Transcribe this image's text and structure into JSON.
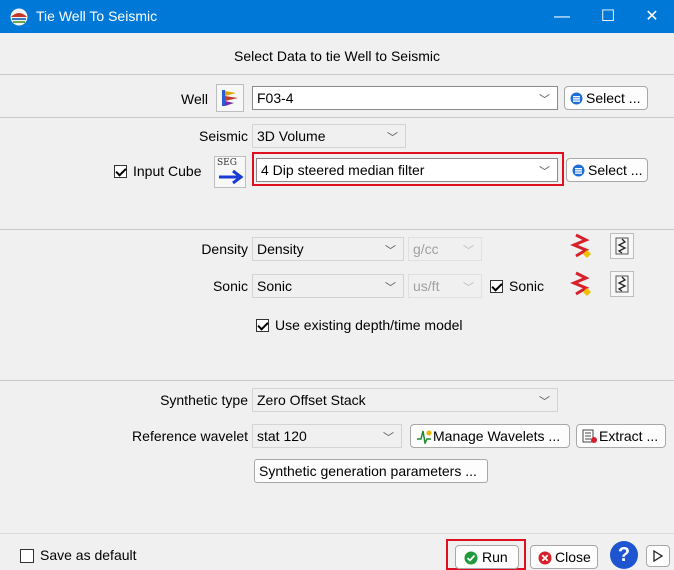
{
  "window": {
    "title": "Tie Well To Seismic",
    "min_glyph": "—",
    "max_glyph": "☐",
    "close_glyph": "✕"
  },
  "header": {
    "title": "Select Data to tie Well to Seismic"
  },
  "well": {
    "label": "Well",
    "value": "F03-4",
    "select_label": "Select ..."
  },
  "seismic": {
    "label": "Seismic",
    "value": "3D Volume"
  },
  "input_cube": {
    "checkbox_label": "Input Cube",
    "checked": true,
    "value": "4 Dip steered median filter",
    "select_label": "Select ...",
    "segy_text": "SEG"
  },
  "density": {
    "label": "Density",
    "value": "Density",
    "unit": "g/cc"
  },
  "sonic": {
    "label": "Sonic",
    "value": "Sonic",
    "unit": "us/ft",
    "checkbox_label": "Sonic",
    "checked": true
  },
  "depth_model": {
    "checkbox_label": "Use existing depth/time model",
    "checked": true
  },
  "synthetic": {
    "label": "Synthetic type",
    "value": "Zero Offset Stack"
  },
  "wavelet": {
    "label": "Reference wavelet",
    "value": "stat 120",
    "manage_label": "Manage Wavelets ...",
    "extract_label": "Extract ..."
  },
  "synth_params": {
    "label": "Synthetic generation parameters ..."
  },
  "footer": {
    "save_default_label": "Save as default",
    "run_label": "Run",
    "close_label": "Close",
    "help_glyph": "?"
  },
  "colors": {
    "titlebar": "#0078d7",
    "highlight": "#e01020"
  }
}
